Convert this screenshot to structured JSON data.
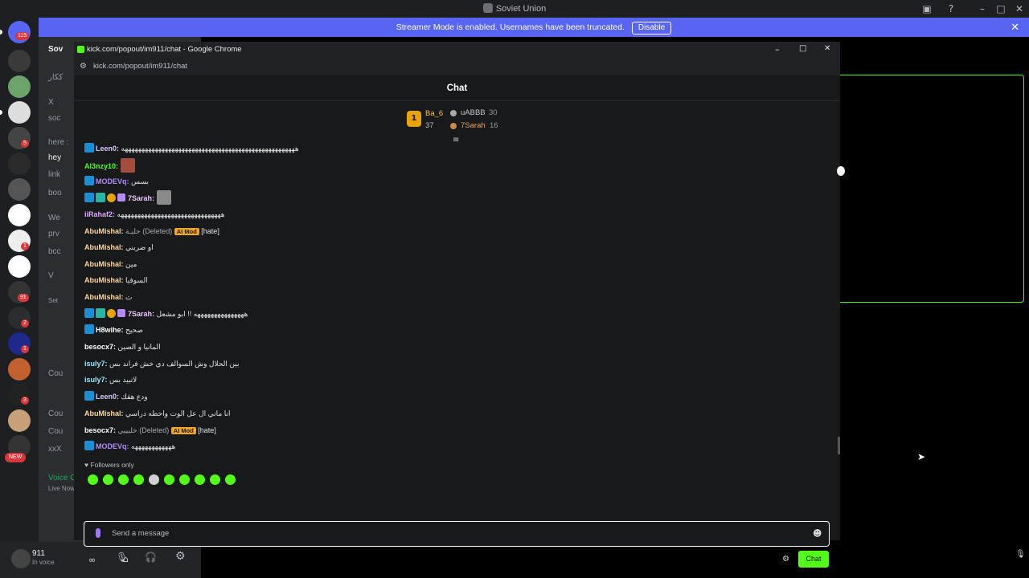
{
  "discord": {
    "server_title": "Soviet Union",
    "banner_text": "Streamer Mode is enabled. Usernames have been truncated.",
    "banner_button": "Disable",
    "rail_badges": [
      "115",
      "5",
      "1",
      "91",
      "2",
      "1",
      "3"
    ],
    "new_label": "NEW",
    "channel_fragments": [
      "Sov",
      "ككار",
      "X",
      "soc",
      "here :",
      "hey",
      "link",
      "boo",
      "We",
      "prv",
      "bcc",
      "V",
      "Set",
      "Cou",
      "Cou",
      "Cou",
      "xxX"
    ],
    "voice": {
      "title": "Voice Conn",
      "sub": "Live Now"
    },
    "user": {
      "name": "911",
      "status": "In voice"
    }
  },
  "chrome": {
    "window_title": "kick.com/popout/im911/chat - Google Chrome",
    "url": "kick.com/popout/im911/chat"
  },
  "chat": {
    "header": "Chat",
    "leaderboard": {
      "first": {
        "rank": "1",
        "name": "Ba_6",
        "count": "37"
      },
      "second": {
        "name": "uABBB",
        "count": "30"
      },
      "third": {
        "name": "7Sarah",
        "count": "16"
      }
    },
    "messages": [
      {
        "user": "Leen0:",
        "color": "#d8c7ff",
        "text": "ههههههههههههههههههههههههههههههههههههههههههههههههههههه",
        "badges": "b"
      },
      {
        "user": "Al3nzy10:",
        "color": "#53fc18",
        "text": "",
        "emote": true
      },
      {
        "user": "MODEVq:",
        "color": "#b48bfa",
        "text": "بسس",
        "badges": "b"
      },
      {
        "user": "7Sarah:",
        "color": "#f0c1ff",
        "text": "",
        "badges": "bgyp",
        "emote": true
      },
      {
        "user": "iiRahaf2:",
        "color": "#e0a5ff",
        "text": "هههههههههههههههههههههههههههههههه"
      },
      {
        "user": "AbuMishal:",
        "color": "#ffd89c",
        "text": "حليـة (Deleted)",
        "mod": "AI Mod",
        "tag": "[hate]"
      },
      {
        "user": "AbuMishal:",
        "color": "#ffd89c",
        "text": "او ضربني"
      },
      {
        "user": "AbuMishal:",
        "color": "#ffd89c",
        "text": "مين"
      },
      {
        "user": "AbuMishal:",
        "color": "#ffd89c",
        "text": "السوفيا"
      },
      {
        "user": "AbuMishal:",
        "color": "#ffd89c",
        "text": "ت"
      },
      {
        "user": "7Sarah:",
        "color": "#f0c1ff",
        "text": "هههههههههههههههه !! ابو مشعل",
        "badges": "bgyp"
      },
      {
        "user": "H8wihe:",
        "color": "#ffffff",
        "text": "صحيح",
        "badges": "b"
      },
      {
        "user": "besocx7:",
        "color": "#ffffff",
        "text": "المانيا و الصين"
      },
      {
        "user": "isuly7:",
        "color": "#9ee7ff",
        "text": "بين الحلال وش السوالف دي خش فراند بس"
      },
      {
        "user": "isuly7:",
        "color": "#9ee7ff",
        "text": "لاتبيد بس"
      },
      {
        "user": "Leen0:",
        "color": "#d8c7ff",
        "text": "ودع هقك",
        "badges": "b"
      },
      {
        "user": "AbuMishal:",
        "color": "#ffd89c",
        "text": "انا ماني ال عل الوت واحطه دراسي"
      },
      {
        "user": "besocx7:",
        "color": "#ffffff",
        "text": "خليييي (Deleted)",
        "mod": "AI Mod",
        "tag": "[hate]"
      },
      {
        "user": "MODEVq:",
        "color": "#b48bfa",
        "text": "ههههههههههههه",
        "badges": "b"
      }
    ],
    "followers_only": "Followers only",
    "input_placeholder": "Send a message",
    "send_button": "Chat"
  },
  "colors": {
    "kick_green": "#53fc18",
    "discord_blurple": "#5865f2"
  }
}
